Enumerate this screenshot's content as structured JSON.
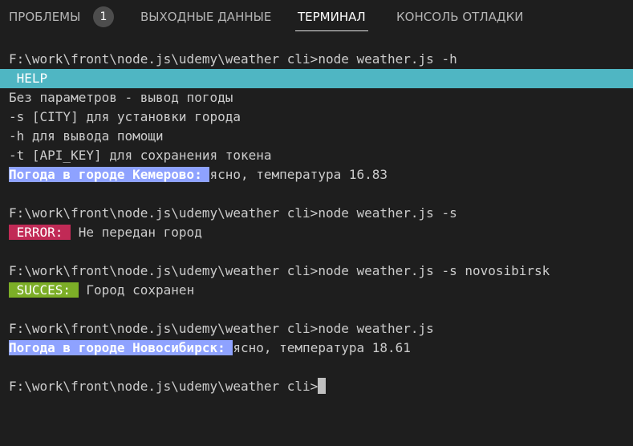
{
  "tabs": {
    "problems": "ПРОБЛЕМЫ",
    "problems_count": "1",
    "output": "ВЫХОДНЫЕ ДАННЫЕ",
    "terminal": "ТЕРМИНАЛ",
    "debug_console": "КОНСОЛЬ ОТЛАДКИ"
  },
  "terminal": {
    "cmd_help": "F:\\work\\front\\node.js\\udemy\\weather cli>node weather.js -h",
    "help_badge": " HELP",
    "help_lines": [
      "Без параметров - вывод погоды",
      "-s [CITY] для установки города",
      "-h для вывода помощи",
      "-t [API_KEY] для сохранения токена"
    ],
    "weather1_label": "Погода в городе Кемерово: ",
    "weather1_text": "ясно, температура 16.83",
    "cmd_s": "F:\\work\\front\\node.js\\udemy\\weather cli>node weather.js -s",
    "error_badge": " ERROR: ",
    "error_text": " Не передан город",
    "cmd_s_city": "F:\\work\\front\\node.js\\udemy\\weather cli>node weather.js -s novosibirsk",
    "success_badge": " SUCCES: ",
    "success_text": " Город сохранен",
    "cmd_plain": "F:\\work\\front\\node.js\\udemy\\weather cli>node weather.js",
    "weather2_label": "Погода в городе Новосибирск: ",
    "weather2_text": "ясно, температура 18.61",
    "prompt": "F:\\work\\front\\node.js\\udemy\\weather cli>"
  },
  "colors": {
    "background": "#1e1e1e",
    "help": "#4fb6c3",
    "weather_label": "#8ea2ff",
    "error": "#c12a56",
    "success": "#7cae27"
  }
}
